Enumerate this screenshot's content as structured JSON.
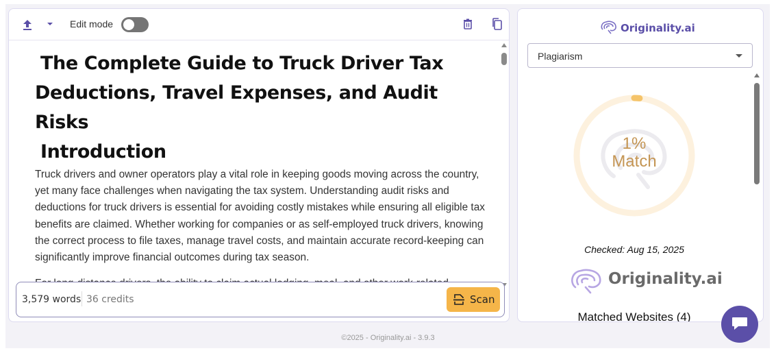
{
  "toolbar": {
    "edit_mode_label": "Edit mode",
    "edit_mode_on": false
  },
  "document": {
    "title_line1": "The Complete Guide to Truck Driver Tax",
    "title_line2": "Deductions, Travel Expenses, and Audit Risks",
    "heading2": "Introduction",
    "paragraphs": [
      "Truck drivers and owner operators play a vital role in keeping goods moving across the country, yet many face challenges when navigating the tax system.  Understanding audit risks and deductions for truck drivers is essential for avoiding costly mistakes while ensuring all eligible tax benefits are claimed.  Whether working for companies or as self-employed truck drivers, knowing the correct process to file taxes, manage travel costs, and maintain accurate record-keeping can significantly improve financial outcomes during tax season.",
      "For long-distance drivers, the ability to claim actual lodging, meal, and other work-related expenses can lead to substantial tax savings.  Determining when to apply the per diem rate"
    ]
  },
  "editor_footer": {
    "word_count": "3,579 words",
    "credits": "36 credits",
    "scan_label": "Scan"
  },
  "panel": {
    "brand_name": "Originality.ai",
    "select_value": "Plagiarism",
    "match_percent_text": "1%",
    "match_label": "Match",
    "match_fraction": 0.01,
    "checked": "Checked: Aug 15, 2025",
    "brand_big": "Originality.ai",
    "matched_websites": "Matched Websites (4)"
  },
  "footer": {
    "text": "©2025 - Originality.ai - 3.9.3"
  },
  "colors": {
    "brand_purple": "#5b4fa8",
    "scan_orange": "#f5b549",
    "match_gold": "#c49553",
    "gauge_track": "#fdf1de",
    "gauge_fill": "#f5c46a"
  }
}
